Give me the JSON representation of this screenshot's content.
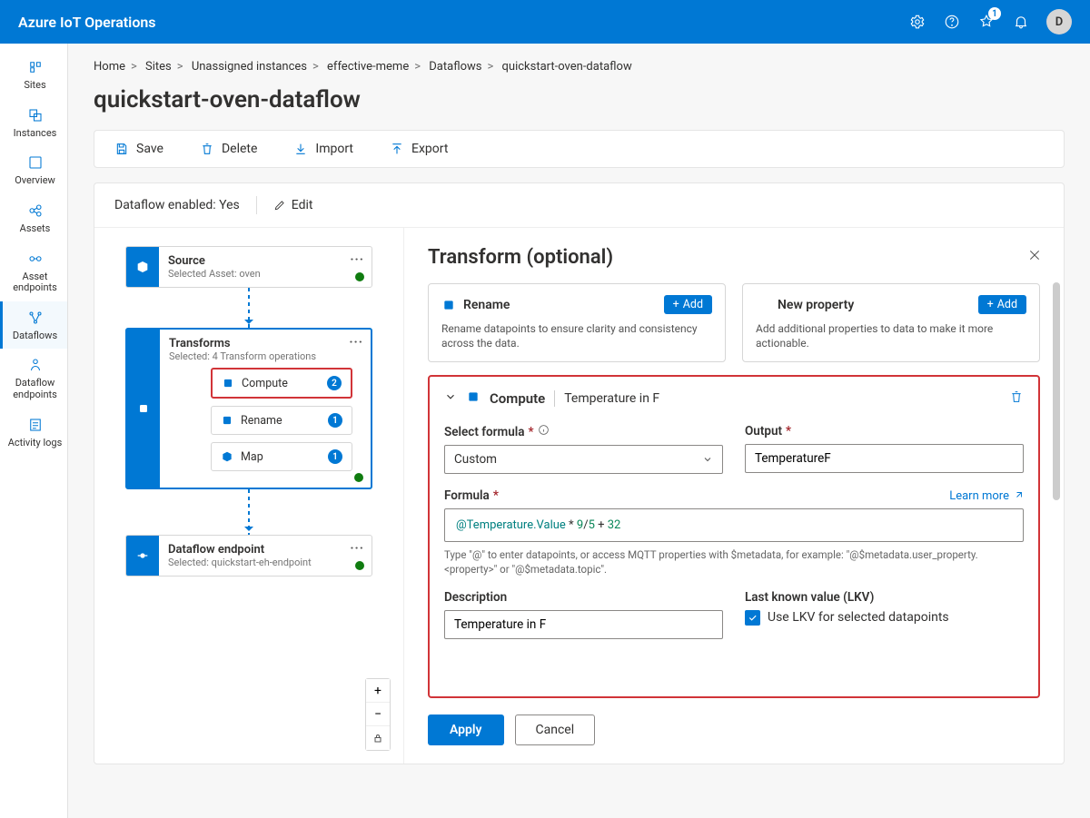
{
  "topbar": {
    "title": "Azure IoT Operations",
    "notif_count": "1",
    "avatar_initial": "D"
  },
  "leftnav": {
    "items": [
      {
        "label": "Sites"
      },
      {
        "label": "Instances"
      },
      {
        "label": "Overview"
      },
      {
        "label": "Assets"
      },
      {
        "label": "Asset endpoints"
      },
      {
        "label": "Dataflows"
      },
      {
        "label": "Dataflow endpoints"
      },
      {
        "label": "Activity logs"
      }
    ]
  },
  "breadcrumb": {
    "items": [
      "Home",
      "Sites",
      "Unassigned instances",
      "effective-meme",
      "Dataflows",
      "quickstart-oven-dataflow"
    ]
  },
  "page_title": "quickstart-oven-dataflow",
  "toolbar": {
    "save": "Save",
    "delete": "Delete",
    "import": "Import",
    "export": "Export"
  },
  "canvas": {
    "enabled_label": "Dataflow enabled: ",
    "enabled_value": "Yes",
    "edit": "Edit",
    "source": {
      "title": "Source",
      "sub": "Selected Asset: oven"
    },
    "transforms": {
      "title": "Transforms",
      "sub": "Selected: 4 Transform operations"
    },
    "sub_compute": {
      "name": "Compute",
      "badge": "2"
    },
    "sub_rename": {
      "name": "Rename",
      "badge": "1"
    },
    "sub_map": {
      "name": "Map",
      "badge": "1"
    },
    "endpoint": {
      "title": "Dataflow endpoint",
      "sub": "Selected: quickstart-eh-endpoint"
    }
  },
  "panel": {
    "title": "Transform (optional)",
    "rename_card": {
      "title": "Rename",
      "add": "Add",
      "desc": "Rename datapoints to ensure clarity and consistency across the data."
    },
    "newprop_card": {
      "title": "New property",
      "add": "Add",
      "desc": "Add additional properties to data to make it more actionable."
    },
    "compute": {
      "head_title": "Compute",
      "head_name": "Temperature in F",
      "formula_label": "Select formula",
      "formula_value": "Custom",
      "output_label": "Output",
      "output_value": "TemperatureF",
      "formula_field_label": "Formula",
      "learn_more": "Learn more",
      "formula_tokens": {
        "var": "@Temperature.Value",
        "op1": " * ",
        "n1": "9",
        "slash": "/",
        "n2": "5",
        "op2": " + ",
        "n3": "32"
      },
      "hint": "Type \"@\" to enter datapoints, or access MQTT properties with $metadata, for example: \"@$metadata.user_property.<property>\" or \"@$metadata.topic\".",
      "desc_label": "Description",
      "desc_value": "Temperature in F",
      "lkv_label": "Last known value (LKV)",
      "lkv_check": "Use LKV for selected datapoints"
    },
    "apply": "Apply",
    "cancel": "Cancel"
  }
}
